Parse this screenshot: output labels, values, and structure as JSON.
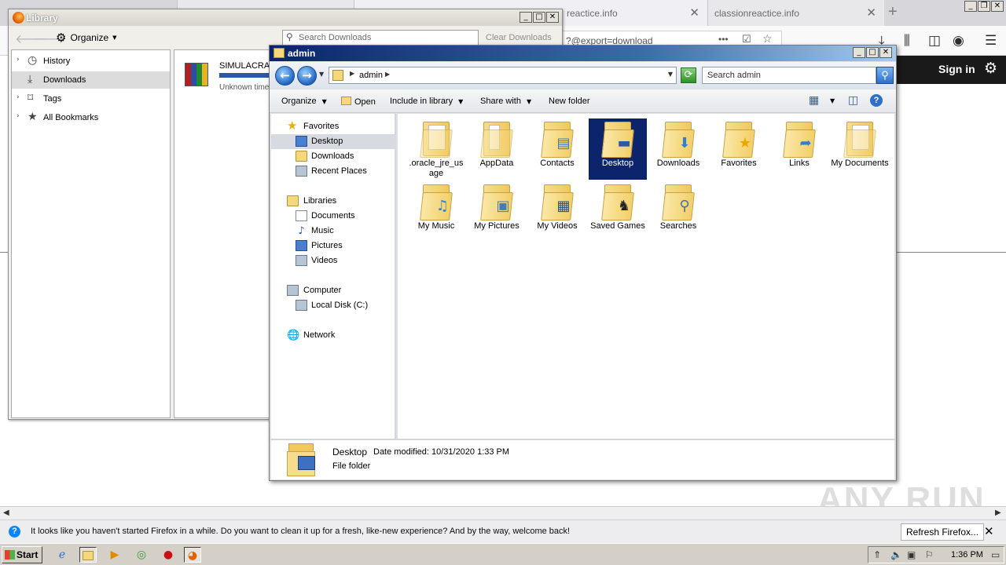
{
  "firefox": {
    "tabs": [
      {
        "title": "reactice.info"
      },
      {
        "title": "classionreactice.info"
      }
    ],
    "url_fragment": "?@export=download",
    "sign_in": "Sign in",
    "notification": {
      "text": "It looks like you haven't started Firefox in a while. Do you want to clean it up for a fresh, like-new experience? And by the way, welcome back!",
      "button": "Refresh Firefox..."
    },
    "watermark": "ANY RUN"
  },
  "library": {
    "title": "Library",
    "organize": "Organize",
    "search_placeholder": "Search Downloads",
    "clear_downloads": "Clear Downloads",
    "tree": [
      {
        "label": "History",
        "icon": "clock-icon"
      },
      {
        "label": "Downloads",
        "icon": "download-icon",
        "selected": true
      },
      {
        "label": "Tags",
        "icon": "tag-icon"
      },
      {
        "label": "All Bookmarks",
        "icon": "star-icon"
      }
    ],
    "download": {
      "name": "SIMULACRA.r",
      "status": "Unknown time"
    }
  },
  "explorer": {
    "title": "admin",
    "breadcrumb": "admin",
    "search_placeholder": "Search admin",
    "commands": {
      "organize": "Organize",
      "open": "Open",
      "include": "Include in library",
      "share": "Share with",
      "new_folder": "New folder"
    },
    "nav": {
      "favorites": "Favorites",
      "desktop": "Desktop",
      "downloads": "Downloads",
      "recent": "Recent Places",
      "libraries": "Libraries",
      "documents": "Documents",
      "music": "Music",
      "pictures": "Pictures",
      "videos": "Videos",
      "computer": "Computer",
      "local_disk": "Local Disk (C:)",
      "network": "Network"
    },
    "folders": [
      {
        "label": ".oracle_jre_usage",
        "icon": "document-folder-icon"
      },
      {
        "label": "AppData",
        "icon": "folder-icon"
      },
      {
        "label": "Contacts",
        "icon": "contacts-folder-icon"
      },
      {
        "label": "Desktop",
        "icon": "desktop-folder-icon",
        "selected": true
      },
      {
        "label": "Downloads",
        "icon": "downloads-folder-icon"
      },
      {
        "label": "Favorites",
        "icon": "favorites-folder-icon"
      },
      {
        "label": "Links",
        "icon": "links-folder-icon"
      },
      {
        "label": "My Documents",
        "icon": "documents-folder-icon"
      },
      {
        "label": "My Music",
        "icon": "music-folder-icon"
      },
      {
        "label": "My Pictures",
        "icon": "pictures-folder-icon"
      },
      {
        "label": "My Videos",
        "icon": "videos-folder-icon"
      },
      {
        "label": "Saved Games",
        "icon": "games-folder-icon"
      },
      {
        "label": "Searches",
        "icon": "searches-folder-icon"
      }
    ],
    "details": {
      "name": "Desktop",
      "modified": "Date modified: 10/31/2020 1:33 PM",
      "type": "File folder"
    }
  },
  "taskbar": {
    "start": "Start",
    "clock": "1:36 PM"
  }
}
